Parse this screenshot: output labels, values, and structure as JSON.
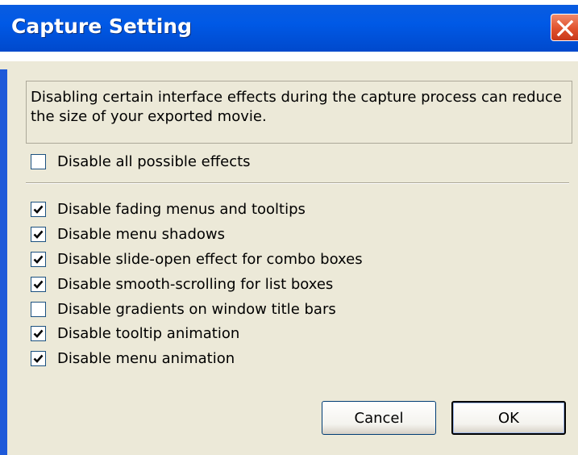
{
  "window": {
    "title": "Capture Setting",
    "close_icon": "close-icon",
    "colors": {
      "titlebar": "#0059e6",
      "close": "#e0512c",
      "dialog_bg": "#ece9d8"
    }
  },
  "description": "Disabling certain interface effects during the capture process can reduce the size of your exported movie.",
  "master_option": {
    "label": "Disable all possible effects",
    "checked": false
  },
  "options": [
    {
      "label": "Disable fading menus and tooltips",
      "checked": true
    },
    {
      "label": "Disable menu shadows",
      "checked": true
    },
    {
      "label": "Disable slide-open effect for combo boxes",
      "checked": true
    },
    {
      "label": "Disable smooth-scrolling for list boxes",
      "checked": true
    },
    {
      "label": "Disable gradients on window title bars",
      "checked": false
    },
    {
      "label": "Disable tooltip animation",
      "checked": true
    },
    {
      "label": "Disable menu animation",
      "checked": true
    }
  ],
  "buttons": {
    "cancel_label": "Cancel",
    "ok_label": "OK"
  }
}
